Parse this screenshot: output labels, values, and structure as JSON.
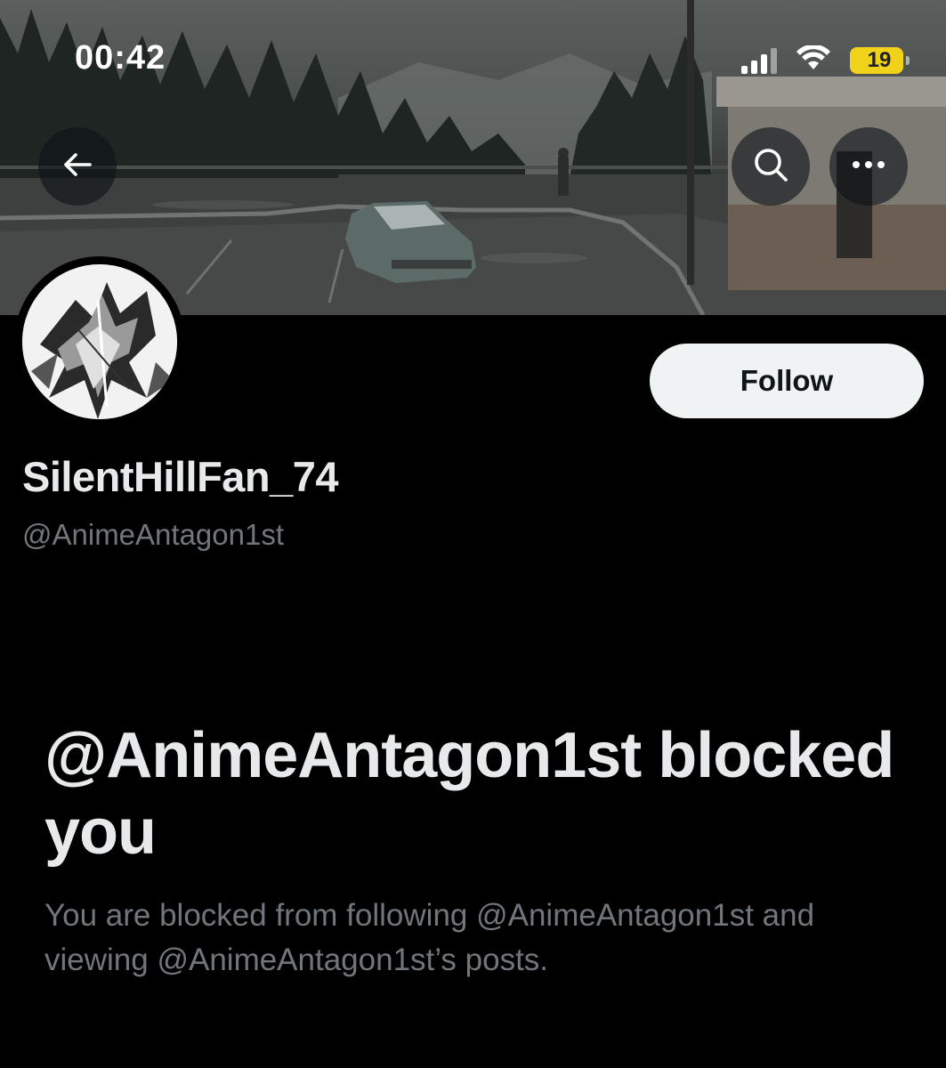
{
  "status_bar": {
    "time": "00:42",
    "battery_text": "19",
    "battery_color": "#f1d21a",
    "icons": [
      "signal-icon",
      "wifi-icon",
      "battery-icon"
    ]
  },
  "header": {
    "back_icon": "arrow-left-icon",
    "search_icon": "search-icon",
    "more_icon": "more-horizontal-icon"
  },
  "profile": {
    "display_name": "SilentHillFan_74",
    "handle": "@AnimeAntagon1st",
    "follow_label": "Follow"
  },
  "blocked": {
    "title": "@AnimeAntagon1st blocked you",
    "description": "You are blocked from following @AnimeAntagon1st and viewing @AnimeAntagon1st’s posts."
  },
  "colors": {
    "background": "#000000",
    "primary_text": "#e7e9ea",
    "secondary_text": "#71767b",
    "follow_button_bg": "#eff3f4"
  }
}
